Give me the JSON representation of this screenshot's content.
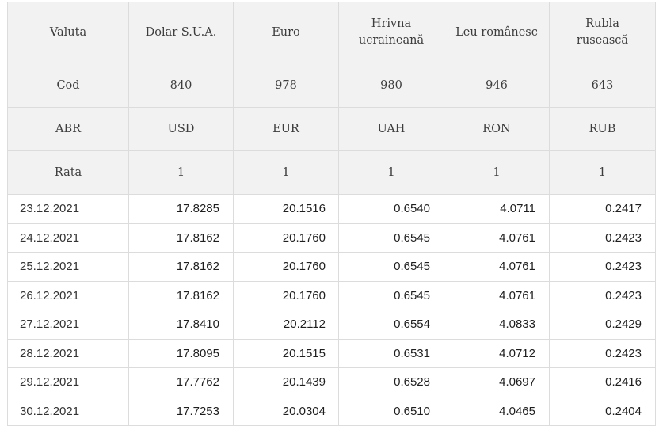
{
  "header": {
    "row_labels": {
      "currency": "Valuta",
      "code": "Cod",
      "abbr": "ABR",
      "rate": "Rata"
    },
    "currencies": [
      {
        "name": "Dolar S.U.A.",
        "code": "840",
        "abbr": "USD",
        "rate": "1"
      },
      {
        "name": "Euro",
        "code": "978",
        "abbr": "EUR",
        "rate": "1"
      },
      {
        "name": "Hrivna ucraineană",
        "code": "980",
        "abbr": "UAH",
        "rate": "1"
      },
      {
        "name": "Leu românesc",
        "code": "946",
        "abbr": "RON",
        "rate": "1"
      },
      {
        "name": "Rubla rusească",
        "code": "643",
        "abbr": "RUB",
        "rate": "1"
      }
    ]
  },
  "rows": [
    {
      "date": "23.12.2021",
      "values": [
        "17.8285",
        "20.1516",
        "0.6540",
        "4.0711",
        "0.2417"
      ]
    },
    {
      "date": "24.12.2021",
      "values": [
        "17.8162",
        "20.1760",
        "0.6545",
        "4.0761",
        "0.2423"
      ]
    },
    {
      "date": "25.12.2021",
      "values": [
        "17.8162",
        "20.1760",
        "0.6545",
        "4.0761",
        "0.2423"
      ]
    },
    {
      "date": "26.12.2021",
      "values": [
        "17.8162",
        "20.1760",
        "0.6545",
        "4.0761",
        "0.2423"
      ]
    },
    {
      "date": "27.12.2021",
      "values": [
        "17.8410",
        "20.2112",
        "0.6554",
        "4.0833",
        "0.2429"
      ]
    },
    {
      "date": "28.12.2021",
      "values": [
        "17.8095",
        "20.1515",
        "0.6531",
        "4.0712",
        "0.2423"
      ]
    },
    {
      "date": "29.12.2021",
      "values": [
        "17.7762",
        "20.1439",
        "0.6528",
        "4.0697",
        "0.2416"
      ]
    },
    {
      "date": "30.12.2021",
      "values": [
        "17.7253",
        "20.0304",
        "0.6510",
        "4.0465",
        "0.2404"
      ]
    }
  ]
}
